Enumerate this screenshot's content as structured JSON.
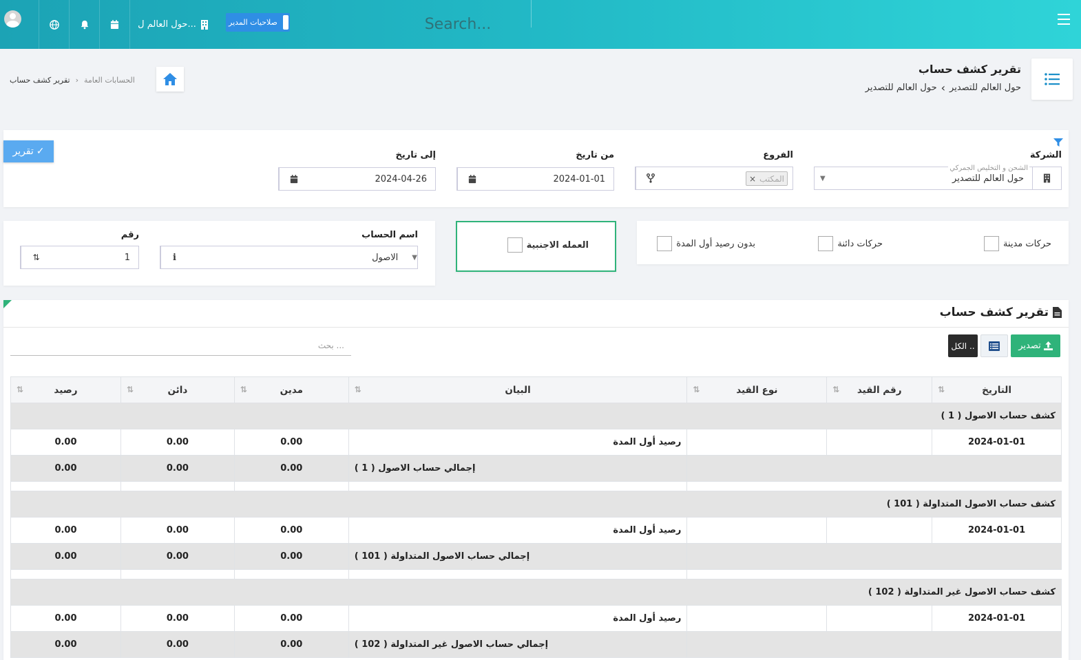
{
  "topbar": {
    "company_short": "حول العالم ل...",
    "admin_label": "صلاحيات المدير",
    "search_placeholder": "Search..."
  },
  "page": {
    "title": "تقرير كشف حساب",
    "subtitle_a": "حول العالم للتصدير",
    "subtitle_b": "حول العالم للتصدير",
    "breadcrumb_parent": "الحسابات العامة",
    "breadcrumb_current": "تقرير كشف حساب"
  },
  "filters": {
    "company_label": "الشركة",
    "company_hint": "الشحن و التخليص الجمركي",
    "company_value": "حول العالم للتصدير",
    "branches_label": "الفروع",
    "branch_chip": "المكتب",
    "from_label": "من تاريخ",
    "from_value": "2024-01-01",
    "to_label": "إلى تاريخ",
    "to_value": "2024-04-26",
    "report_button": "تقرير"
  },
  "options": {
    "debit_moves": "حركات مدينة",
    "credit_moves": "حركات دائنة",
    "no_opening": "بدون رصيد أول المدة",
    "foreign_currency": "العمله الاجنبية"
  },
  "account": {
    "name_label": "اسم الحساب",
    "name_value": "الاصول",
    "number_label": "رقم",
    "number_value": "1"
  },
  "table": {
    "title": "تقرير كشف حساب",
    "export_label": "تصدير",
    "all_label": "الكل ..",
    "search_placeholder": "بحث ...",
    "columns": [
      "التاريخ",
      "رقم القيد",
      "نوع القيد",
      "البيان",
      "مدين",
      "دائن",
      "رصيد"
    ],
    "groups": [
      {
        "header": "كشف حساب الاصول ( 1 )",
        "opening": {
          "date": "2024-01-01",
          "desc": "رصيد أول المدة",
          "debit": "0.00",
          "credit": "0.00",
          "balance": "0.00"
        },
        "total": {
          "desc": "إجمالي حساب الاصول ( 1 )",
          "debit": "0.00",
          "credit": "0.00",
          "balance": "0.00"
        }
      },
      {
        "header": "كشف حساب الاصول المتداولة ( 101 )",
        "opening": {
          "date": "2024-01-01",
          "desc": "رصيد أول المدة",
          "debit": "0.00",
          "credit": "0.00",
          "balance": "0.00"
        },
        "total": {
          "desc": "إجمالي حساب الاصول المتداولة ( 101 )",
          "debit": "0.00",
          "credit": "0.00",
          "balance": "0.00"
        }
      },
      {
        "header": "كشف حساب الاصول غير المتداولة ( 102 )",
        "opening": {
          "date": "2024-01-01",
          "desc": "رصيد أول المدة",
          "debit": "0.00",
          "credit": "0.00",
          "balance": "0.00"
        },
        "total": {
          "desc": "إجمالي حساب الاصول غير المتداولة ( 102 )",
          "debit": "0.00",
          "credit": "0.00",
          "balance": "0.00"
        }
      }
    ]
  }
}
